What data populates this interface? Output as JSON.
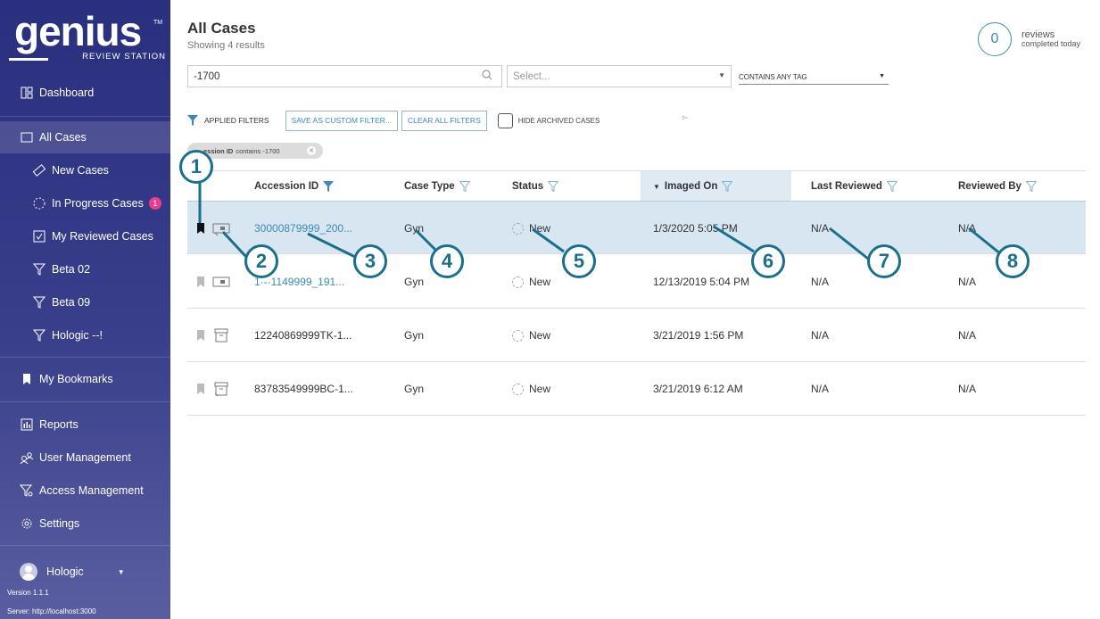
{
  "app": {
    "logo_text": "genius",
    "logo_tm": "TM",
    "logo_sub": "REVIEW STATION"
  },
  "sidebar": {
    "items": [
      {
        "label": "Dashboard",
        "icon": "dashboard-icon"
      },
      {
        "label": "All Cases",
        "icon": "folder-icon",
        "active": true
      },
      {
        "label": "New Cases",
        "icon": "slide-icon"
      },
      {
        "label": "In Progress Cases",
        "icon": "progress-icon",
        "badge": "1"
      },
      {
        "label": "My Reviewed Cases",
        "icon": "checkbox-icon"
      },
      {
        "label": "Beta 02",
        "icon": "filter-icon"
      },
      {
        "label": "Beta 09",
        "icon": "filter-icon"
      },
      {
        "label": "Hologic --!",
        "icon": "filter-icon"
      },
      {
        "label": "My Bookmarks",
        "icon": "bookmark-icon"
      },
      {
        "label": "Reports",
        "icon": "reports-icon"
      },
      {
        "label": "User Management",
        "icon": "users-icon"
      },
      {
        "label": "Access Management",
        "icon": "access-icon"
      },
      {
        "label": "Settings",
        "icon": "gear-icon"
      }
    ],
    "user": "Hologic",
    "version": "Version 1.1.1",
    "server": "Server: http://localhost:3000"
  },
  "header": {
    "title": "All Cases",
    "subtitle": "Showing 4 results",
    "reviews_count": "0",
    "reviews_label": "reviews",
    "reviews_sub": "completed today"
  },
  "filters": {
    "search_value": "-1700",
    "tag_placeholder": "Select...",
    "tag_mode": "CONTAINS ANY TAG",
    "applied_label": "APPLIED FILTERS",
    "save_button": "SAVE AS CUSTOM FILTER...",
    "clear_button": "CLEAR ALL FILTERS",
    "hide_archived": "HIDE ARCHIVED CASES",
    "chip_field": "ession ID",
    "chip_rest": "contains -1700"
  },
  "table": {
    "columns": [
      "Accession ID",
      "Case Type",
      "Status",
      "Imaged On",
      "Last Reviewed",
      "Reviewed By"
    ],
    "sorted_column": "Imaged On",
    "rows": [
      {
        "accession": "30000879999_200...",
        "case_type": "Gyn",
        "status": "New",
        "imaged_on": "1/3/2020 5:05 PM",
        "last_reviewed": "N/A",
        "reviewed_by": "N/A"
      },
      {
        "accession": "1·-·1149999_191...",
        "case_type": "Gyn",
        "status": "New",
        "imaged_on": "12/13/2019 5:04 PM",
        "last_reviewed": "N/A",
        "reviewed_by": "N/A"
      },
      {
        "accession": "12240869999TK-1...",
        "case_type": "Gyn",
        "status": "New",
        "imaged_on": "3/21/2019 1:56 PM",
        "last_reviewed": "N/A",
        "reviewed_by": "N/A"
      },
      {
        "accession": "83783549999BC-1...",
        "case_type": "Gyn",
        "status": "New",
        "imaged_on": "3/21/2019 6:12 AM",
        "last_reviewed": "N/A",
        "reviewed_by": "N/A"
      }
    ]
  },
  "callouts": [
    "1",
    "2",
    "3",
    "4",
    "5",
    "6",
    "7",
    "8"
  ],
  "colors": {
    "sidebar": "#2a2f7e",
    "accent": "#3b8ab8",
    "callout": "#1a6e8e",
    "selected_row": "#d7e6f1",
    "badge": "#e83e8c"
  }
}
